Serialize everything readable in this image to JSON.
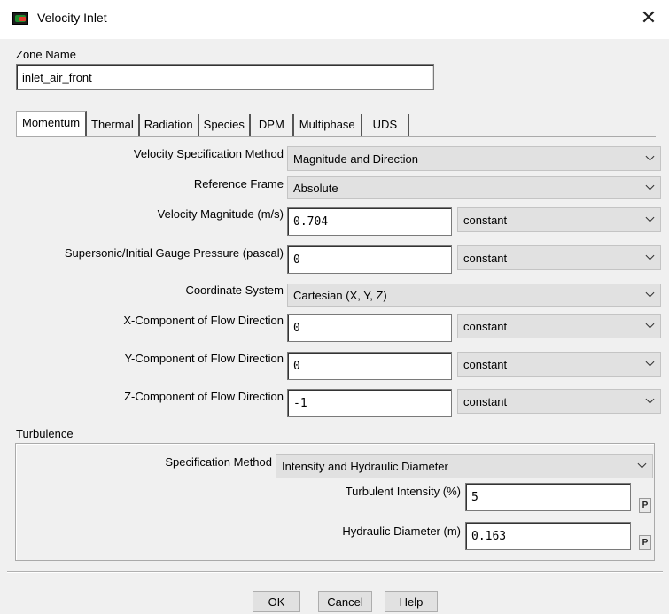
{
  "window": {
    "title": "Velocity Inlet",
    "close_glyph": "✕"
  },
  "zone": {
    "label": "Zone Name",
    "value": "inlet_air_front"
  },
  "tabs": [
    "Momentum",
    "Thermal",
    "Radiation",
    "Species",
    "DPM",
    "Multiphase",
    "UDS"
  ],
  "active_tab": "Momentum",
  "momentum": {
    "velocity_spec_method": {
      "label": "Velocity Specification Method",
      "value": "Magnitude and Direction"
    },
    "reference_frame": {
      "label": "Reference Frame",
      "value": "Absolute"
    },
    "velocity_magnitude": {
      "label": "Velocity Magnitude (m/s)",
      "value": "0.704",
      "profile": "constant"
    },
    "gauge_pressure": {
      "label": "Supersonic/Initial Gauge Pressure (pascal)",
      "value": "0",
      "profile": "constant"
    },
    "coordinate_system": {
      "label": "Coordinate System",
      "value": "Cartesian (X, Y, Z)"
    },
    "x_component": {
      "label": "X-Component of Flow Direction",
      "value": "0",
      "profile": "constant"
    },
    "y_component": {
      "label": "Y-Component of Flow Direction",
      "value": "0",
      "profile": "constant"
    },
    "z_component": {
      "label": "Z-Component of Flow Direction",
      "value": "-1",
      "profile": "constant"
    }
  },
  "turbulence": {
    "group_label": "Turbulence",
    "spec_method": {
      "label": "Specification Method",
      "value": "Intensity and Hydraulic Diameter"
    },
    "intensity": {
      "label": "Turbulent Intensity (%)",
      "value": "5",
      "param_button": "P"
    },
    "hydraulic_diameter": {
      "label": "Hydraulic Diameter (m)",
      "value": "0.163",
      "param_button": "P"
    }
  },
  "buttons": {
    "ok": "OK",
    "cancel": "Cancel",
    "help": "Help"
  },
  "icons": {
    "app": "fluent-app-icon",
    "close": "close-icon",
    "dropdown": "chevron-down-icon"
  }
}
